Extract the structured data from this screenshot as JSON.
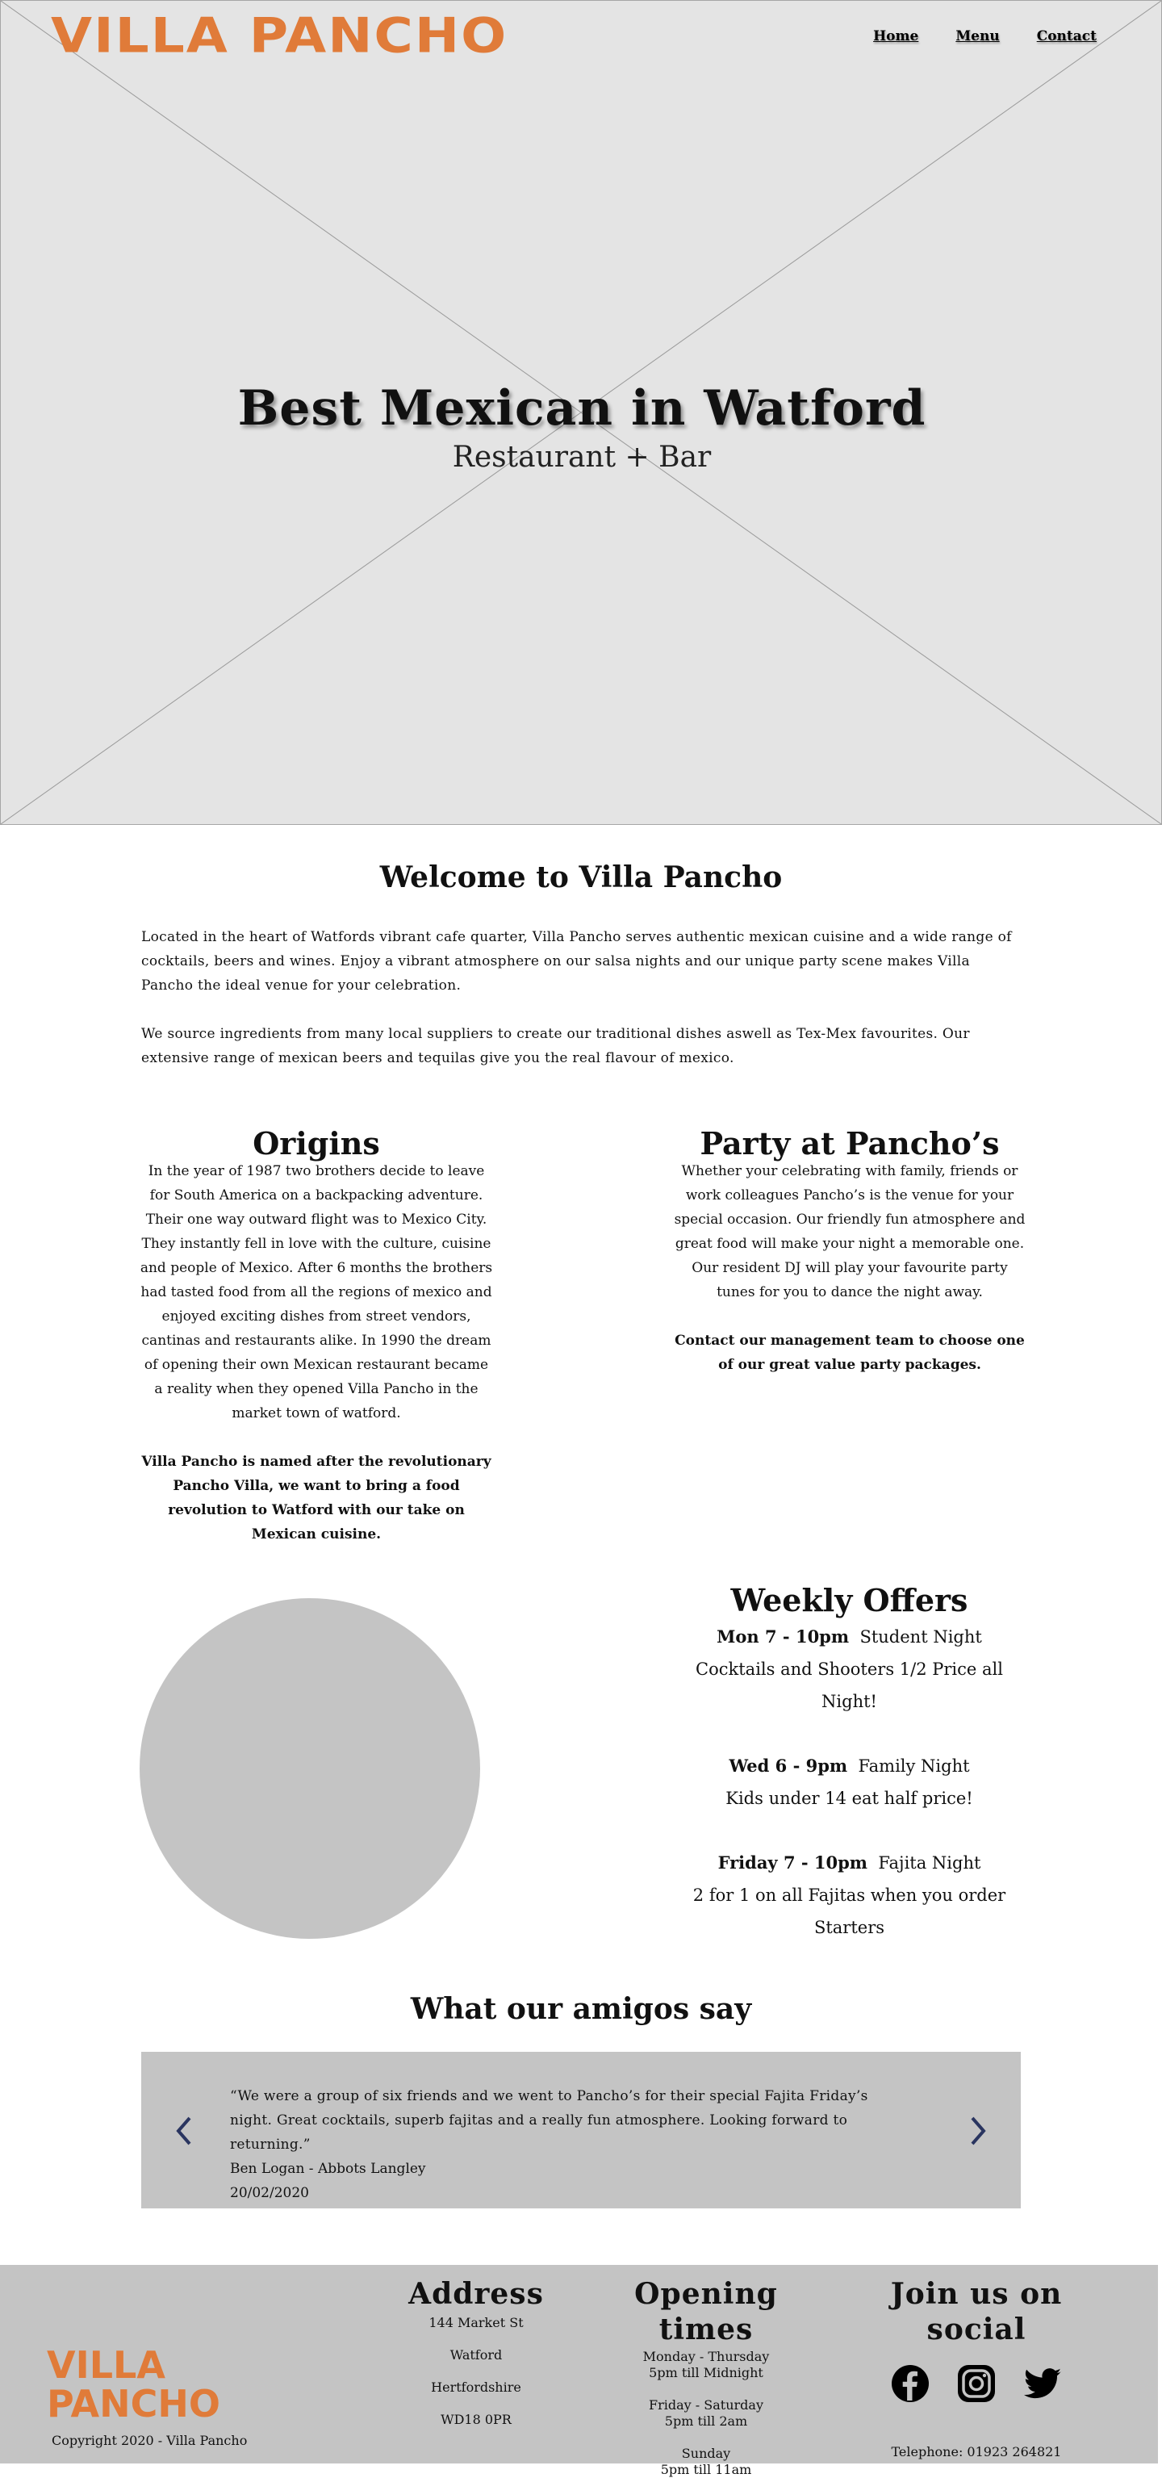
{
  "brand": {
    "logo_text": "VILLA PANCHO",
    "logo_color": "#e07b39"
  },
  "nav": {
    "items": [
      "Home",
      "Menu",
      "Contact"
    ]
  },
  "hero": {
    "title": "Best Mexican in Watford",
    "subtitle": "Restaurant + Bar"
  },
  "welcome": {
    "heading": "Welcome to Villa Pancho",
    "para1": "Located in the heart of Watfords vibrant cafe quarter, Villa Pancho serves authentic mexican cuisine and a wide range of cocktails, beers and wines. Enjoy a vibrant atmosphere on our salsa nights and our unique party scene makes Villa Pancho the ideal venue for your celebration.",
    "para2": "We source ingredients from many local suppliers to create our traditional dishes aswell as Tex-Mex favourites. Our extensive range of mexican beers and tequilas give you the real flavour of mexico."
  },
  "origins": {
    "heading": "Origins",
    "body": "In the year of 1987 two brothers decide to leave for South America on a backpacking adventure. Their one way outward flight was to Mexico City. They instantly fell in love with the culture, cuisine and people of Mexico. After 6 months the brothers had tasted food from all the regions of mexico and enjoyed exciting dishes from street vendors, cantinas and restaurants alike. In 1990 the dream of opening their own Mexican restaurant became a reality when they opened Villa Pancho in the market town of watford.",
    "emphasis": "Villa Pancho is named after the revolutionary Pancho Villa, we want to bring a food revolution to Watford with our take on Mexican cuisine."
  },
  "party": {
    "heading": "Party at Pancho’s",
    "body": "Whether your celebrating with family, friends or work colleagues Pancho’s is the venue for your special occasion. Our friendly fun atmosphere and great food  will make your night a memorable one. Our resident DJ will play your favourite party tunes for you to dance the night away.",
    "emphasis": "Contact our management team to choose one of our great value party packages."
  },
  "offers": {
    "heading": "Weekly Offers",
    "items": [
      {
        "time": "Mon 7 - 10pm",
        "name": "Student Night",
        "desc": "Cocktails and Shooters 1/2 Price all Night!"
      },
      {
        "time": "Wed 6 - 9pm",
        "name": "Family Night",
        "desc": "Kids under 14 eat half price!"
      },
      {
        "time": "Friday 7 - 10pm",
        "name": "Fajita Night",
        "desc": "2 for 1 on all Fajitas when you order Starters"
      }
    ]
  },
  "testimonials": {
    "heading": "What our amigos say",
    "quote": "“We were a group of six friends and we went to Pancho’s for their special Fajita Friday’s night. Great cocktails, superb fajitas and a really fun atmosphere. Looking forward to returning.”",
    "author": "Ben Logan - Abbots Langley",
    "date": "20/02/2020",
    "arrow_color": "#2a3560"
  },
  "footer": {
    "logo_line1": "VILLA",
    "logo_line2": "PANCHO",
    "copyright": "Copyright 2020 - Villa Pancho",
    "address": {
      "heading": "Address",
      "lines": [
        "144 Market St",
        "Watford",
        "Hertfordshire",
        "WD18 0PR"
      ]
    },
    "hours": {
      "heading": "Opening times",
      "lines": [
        [
          "Monday - Thursday",
          "5pm till Midnight"
        ],
        [
          "Friday - Saturday",
          "5pm till 2am"
        ],
        [
          "Sunday",
          "5pm till 11am"
        ]
      ]
    },
    "social": {
      "heading": "Join us on social",
      "icons": [
        "facebook-icon",
        "instagram-icon",
        "twitter-icon"
      ],
      "telephone": "Telephone: 01923 264821"
    }
  }
}
